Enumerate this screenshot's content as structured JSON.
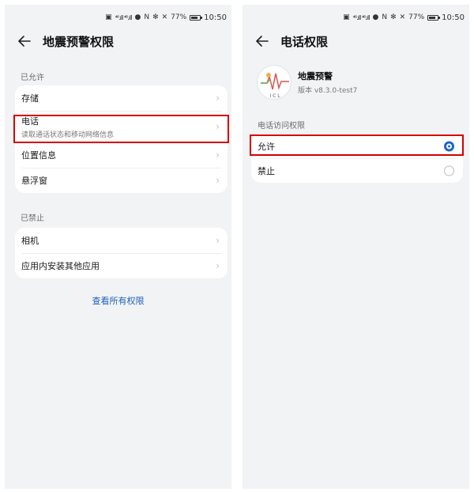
{
  "status_bar": {
    "signal_text": "⁴⁶.ıll ⁴⁶.ıll",
    "battery": "77%",
    "time": "10:50"
  },
  "left": {
    "title": "地震预警权限",
    "allowed_label": "已允许",
    "allowed_items": [
      {
        "label": "存储"
      },
      {
        "label": "电话",
        "sub": "读取通话状态和移动网络信息"
      },
      {
        "label": "位置信息"
      },
      {
        "label": "悬浮窗"
      }
    ],
    "denied_label": "已禁止",
    "denied_items": [
      {
        "label": "相机"
      },
      {
        "label": "应用内安装其他应用"
      }
    ],
    "view_all": "查看所有权限"
  },
  "right": {
    "title": "电话权限",
    "app": {
      "name": "地震预警",
      "version": "版本 v8.3.0-test7",
      "logo_letters": "I C L"
    },
    "section_label": "电话访问权限",
    "options": [
      {
        "label": "允许",
        "selected": true
      },
      {
        "label": "禁止",
        "selected": false
      }
    ]
  },
  "colors": {
    "accent": "#1e64c8",
    "highlight": "#d60000",
    "link": "#1e5fb4",
    "background": "#f1f3f5"
  }
}
